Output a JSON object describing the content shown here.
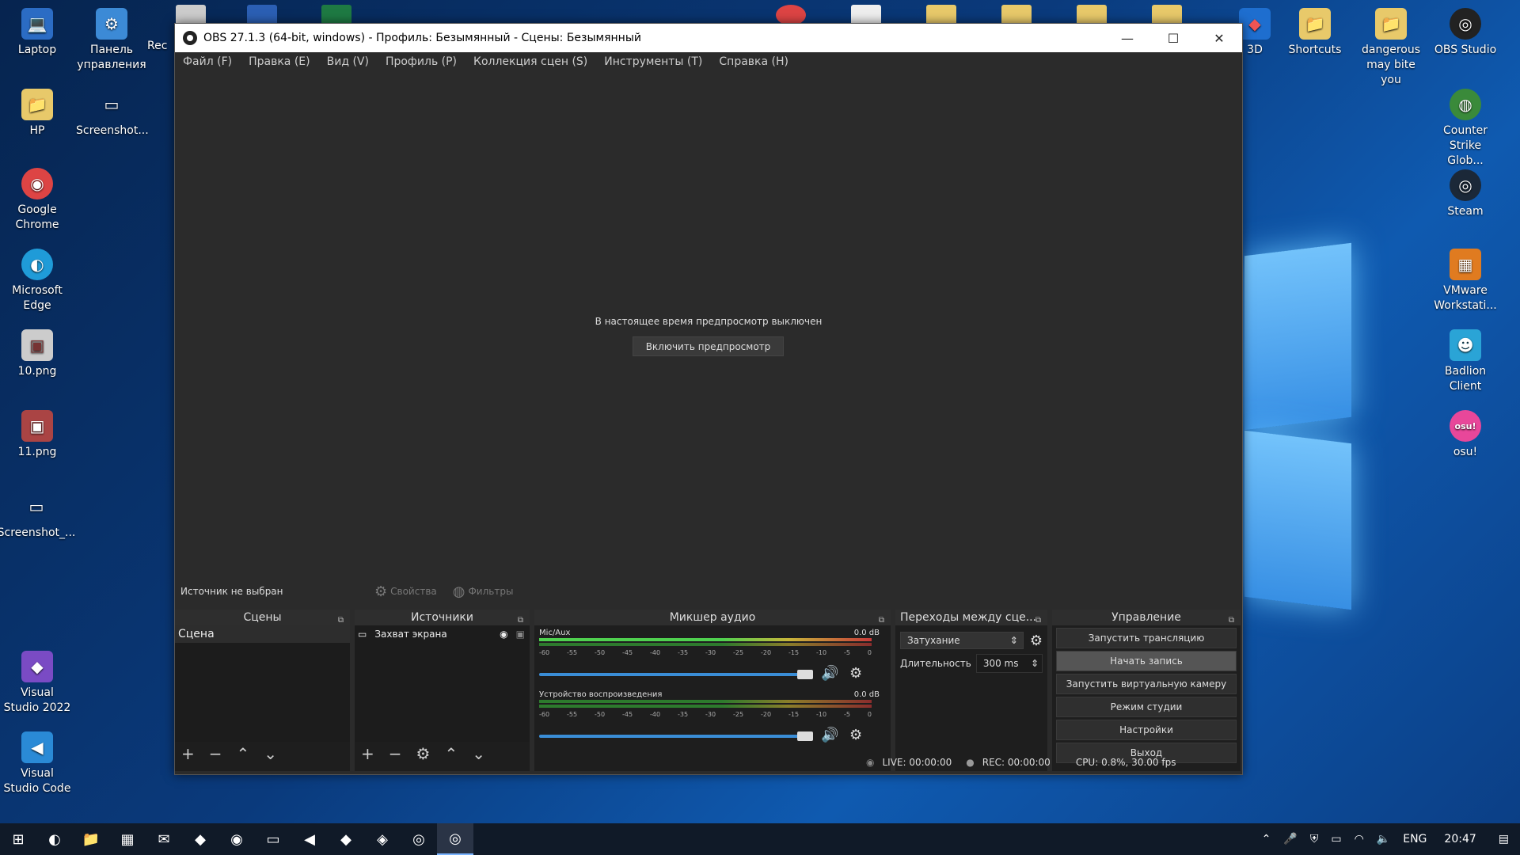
{
  "desktop": {
    "left_icons": [
      {
        "label": "Laptop",
        "glyph": "💻",
        "icon": "laptop-icon"
      },
      {
        "label": "Панель управления",
        "glyph": "⚙",
        "icon": "control-panel-icon"
      },
      {
        "label": "HP",
        "glyph": "📁",
        "icon": "folder-icon"
      },
      {
        "label": "Screenshot...",
        "glyph": "▭",
        "icon": "image-icon"
      },
      {
        "label": "Google Chrome",
        "glyph": "◉",
        "icon": "chrome-icon"
      },
      {
        "label": "Microsoft Edge",
        "glyph": "◐",
        "icon": "edge-icon"
      },
      {
        "label": "10.png",
        "glyph": "▣",
        "icon": "image-icon"
      },
      {
        "label": "11.png",
        "glyph": "▣",
        "icon": "image-icon"
      },
      {
        "label": "Screenshot_...",
        "glyph": "▭",
        "icon": "image-icon"
      },
      {
        "label": "Visual Studio 2022",
        "glyph": "◆",
        "icon": "visual-studio-icon"
      },
      {
        "label": "Visual Studio Code",
        "glyph": "◀",
        "icon": "vscode-icon"
      }
    ],
    "partial_label": "Rec",
    "right_icons": [
      {
        "label": "3D",
        "glyph": "◆",
        "icon": "3d-icon"
      },
      {
        "label": "Shortcuts",
        "glyph": "📁",
        "icon": "folder-icon"
      },
      {
        "label": "dangerous may bite you",
        "glyph": "📁",
        "icon": "folder-icon"
      },
      {
        "label": "OBS Studio",
        "glyph": "◎",
        "icon": "obs-icon"
      },
      {
        "label": "Counter Strike Glob...",
        "glyph": "◍",
        "icon": "game-icon"
      },
      {
        "label": "Steam",
        "glyph": "◎",
        "icon": "steam-icon"
      },
      {
        "label": "VMware Workstati...",
        "glyph": "▦",
        "icon": "vmware-icon"
      },
      {
        "label": "Badlion Client",
        "glyph": "☻",
        "icon": "badlion-icon"
      },
      {
        "label": "osu!",
        "glyph": "osu!",
        "icon": "osu-icon"
      }
    ]
  },
  "window": {
    "title": "OBS 27.1.3 (64-bit, windows) - Профиль: Безымянный - Сцены: Безымянный",
    "controls": {
      "minimize": "—",
      "maximize": "☐",
      "close": "✕"
    },
    "menu": [
      "Файл (F)",
      "Правка (E)",
      "Вид (V)",
      "Профиль (P)",
      "Коллекция сцен (S)",
      "Инструменты (T)",
      "Справка (H)"
    ]
  },
  "preview": {
    "message": "В настоящее время предпросмотр выключен",
    "enable_button": "Включить предпросмотр"
  },
  "context_bar": {
    "source": "Источник не выбран",
    "properties": "Свойства",
    "filters": "Фильтры"
  },
  "docks": {
    "scenes": {
      "title": "Сцены",
      "items": [
        "Сцена"
      ]
    },
    "sources": {
      "title": "Источники",
      "items": [
        "Захват экрана"
      ]
    },
    "mixer": {
      "title": "Микшер аудио",
      "ticks": [
        "-60",
        "-55",
        "-50",
        "-45",
        "-40",
        "-35",
        "-30",
        "-25",
        "-20",
        "-15",
        "-10",
        "-5",
        "0"
      ],
      "channels": [
        {
          "name": "Mic/Aux",
          "db": "0.0 dB"
        },
        {
          "name": "Устройство воспроизведения",
          "db": "0.0 dB"
        }
      ]
    },
    "transitions": {
      "title": "Переходы между сце...",
      "type": "Затухание",
      "duration_label": "Длительность",
      "duration": "300 ms"
    },
    "controls": {
      "title": "Управление",
      "buttons": [
        "Запустить трансляцию",
        "Начать запись",
        "Запустить виртуальную камеру",
        "Режим студии",
        "Настройки",
        "Выход"
      ]
    }
  },
  "status": {
    "live": "LIVE: 00:00:00",
    "rec": "REC: 00:00:00",
    "cpu": "CPU: 0.8%, 30.00 fps"
  },
  "taskbar": {
    "apps": [
      {
        "glyph": "⊞",
        "icon": "windows-start-icon"
      },
      {
        "glyph": "◐",
        "icon": "edge-icon"
      },
      {
        "glyph": "📁",
        "icon": "file-explorer-icon"
      },
      {
        "glyph": "▦",
        "icon": "store-icon"
      },
      {
        "glyph": "✉",
        "icon": "mail-icon"
      },
      {
        "glyph": "◆",
        "icon": "visual-studio-icon"
      },
      {
        "glyph": "◉",
        "icon": "chrome-icon"
      },
      {
        "glyph": "▭",
        "icon": "image-icon"
      },
      {
        "glyph": "◀",
        "icon": "vscode-icon"
      },
      {
        "glyph": "◆",
        "icon": "visual-studio-2022-icon"
      },
      {
        "glyph": "◈",
        "icon": "app-icon"
      },
      {
        "glyph": "◎",
        "icon": "badlion-icon"
      },
      {
        "glyph": "◎",
        "icon": "obs-icon"
      }
    ],
    "lang": "ENG",
    "time": "20:47"
  }
}
